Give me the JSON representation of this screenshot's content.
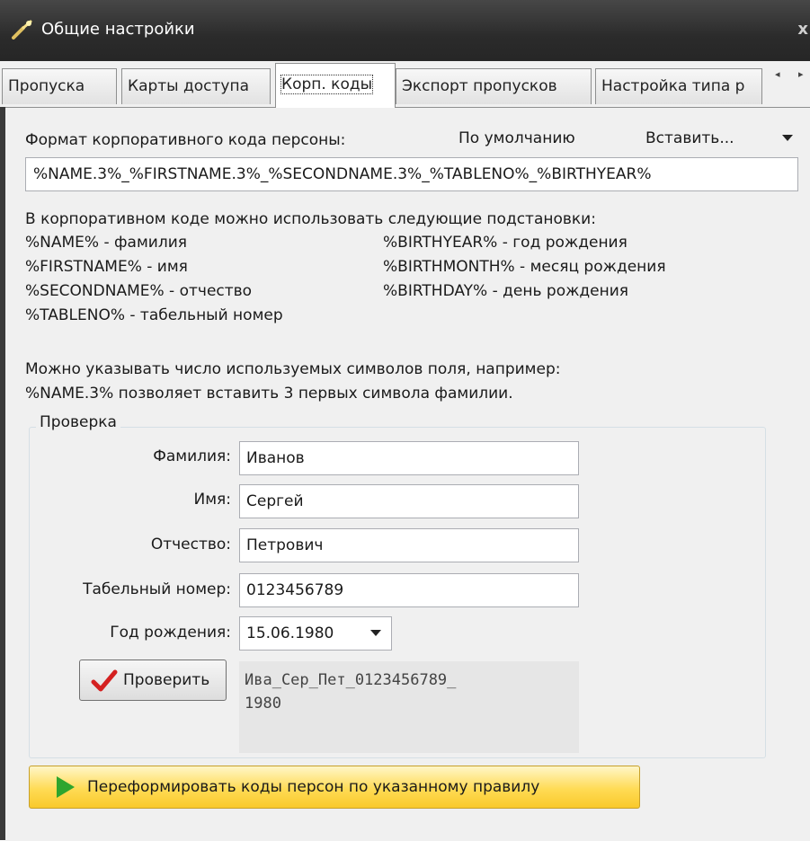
{
  "window": {
    "title": "Общие настройки",
    "close": "x"
  },
  "tabs": [
    {
      "label": "Пропуска"
    },
    {
      "label": "Карты доступа"
    },
    {
      "label": "Корп. коды"
    },
    {
      "label": "Экспорт пропусков"
    },
    {
      "label": "Настройка типа р"
    }
  ],
  "tab_scroll": {
    "left": "◂",
    "right": "▸"
  },
  "format": {
    "label": "Формат корпоративного кода персоны:",
    "default_link": "По умолчанию",
    "insert_label": "Вставить...",
    "value": "%NAME.3%_%FIRSTNAME.3%_%SECONDNAME.3%_%TABLENO%_%BIRTHYEAR%"
  },
  "help": {
    "intro": "В корпоративном коде можно использовать следующие подстановки:",
    "left": [
      "%NAME% - фамилия",
      "%FIRSTNAME% - имя",
      "%SECONDNAME% - отчество",
      "%TABLENO% - табельный номер"
    ],
    "right": [
      "%BIRTHYEAR% - год рождения",
      "%BIRTHMONTH% - месяц рождения",
      "%BIRTHDAY% - день рождения"
    ],
    "note1": "Можно указывать число используемых символов поля, например:",
    "note2": "%NAME.3% позволяет вставить 3 первых символа фамилии."
  },
  "check": {
    "legend": "Проверка",
    "fields": [
      {
        "label": "Фамилия:",
        "value": "Иванов"
      },
      {
        "label": "Имя:",
        "value": "Сергей"
      },
      {
        "label": "Отчество:",
        "value": "Петрович"
      },
      {
        "label": "Табельный номер:",
        "value": "0123456789"
      }
    ],
    "birth_label": "Год рождения:",
    "birth_value": "15.06.1980",
    "check_button": "Проверить",
    "result_line1": "Ива_Сер_Пет_0123456789_",
    "result_line2": "1980"
  },
  "reform_button": "Переформировать коды персон по указанному правилу",
  "colors": {
    "accent_yellow": "#ffdb55",
    "check_red": "#d42020",
    "play_green": "#2ea52e"
  }
}
